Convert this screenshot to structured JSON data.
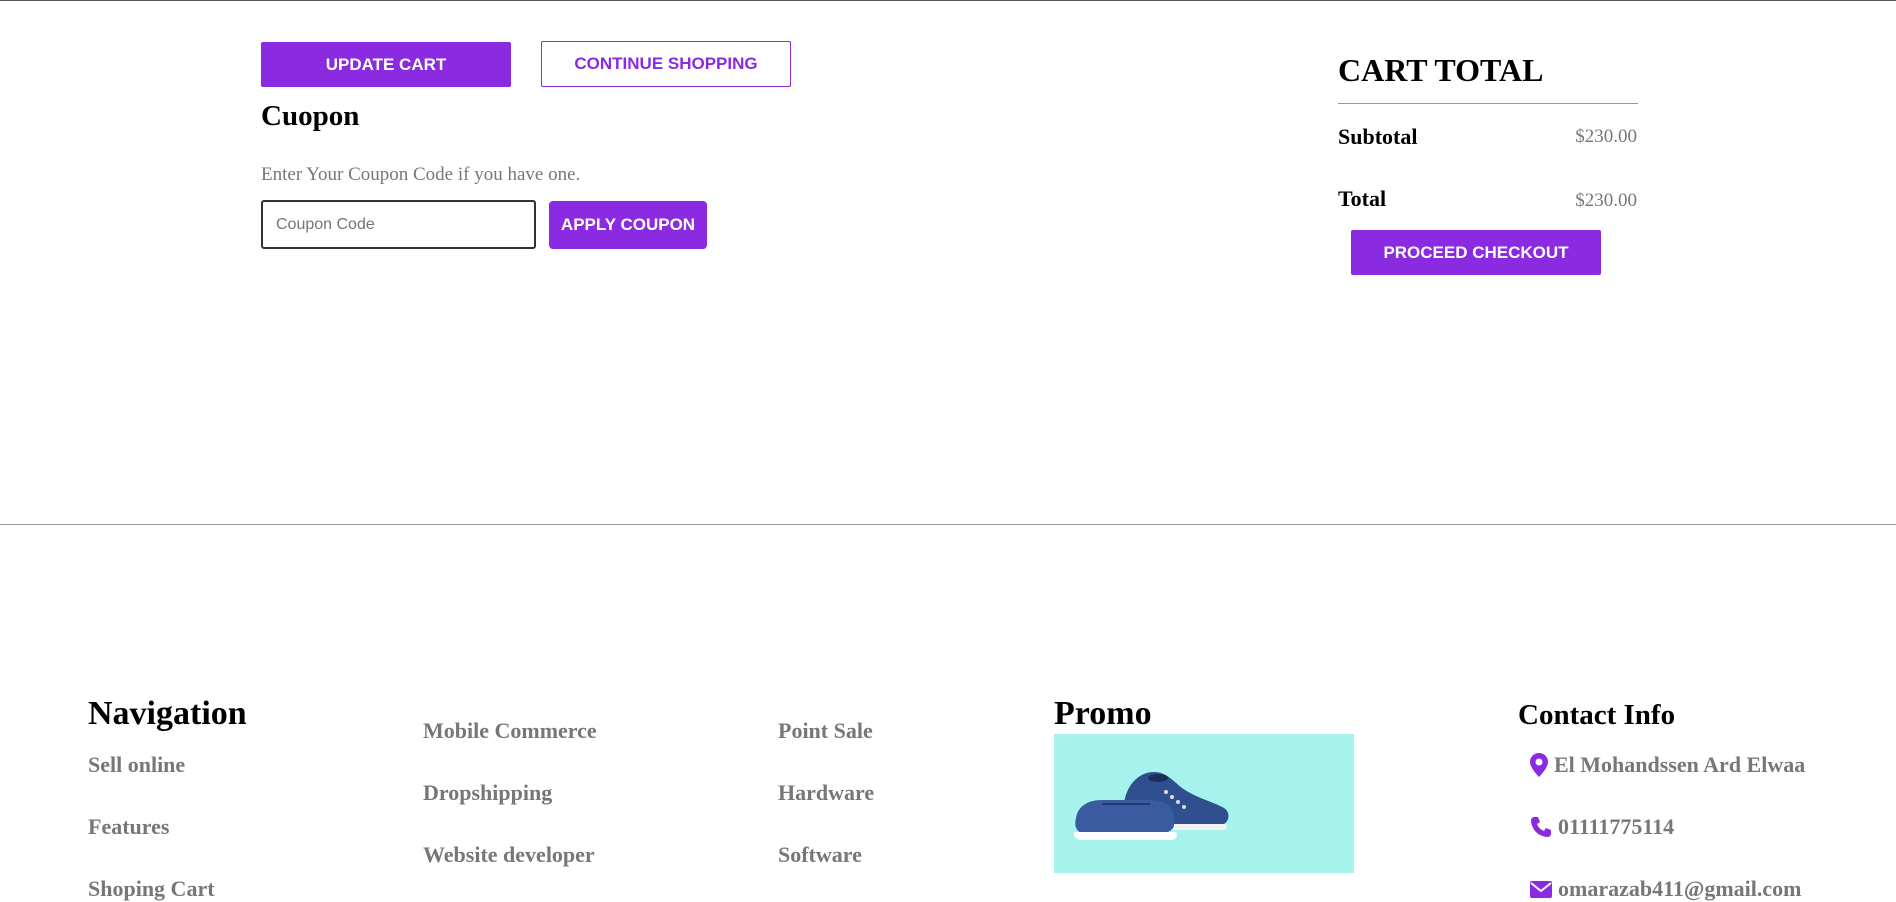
{
  "cart_actions": {
    "update_label": "UPDATE CART",
    "continue_label": "CONTINUE SHOPPING"
  },
  "coupon": {
    "title": "Cuopon",
    "description": "Enter Your Coupon Code if you have one.",
    "placeholder": "Coupon Code",
    "value": "",
    "apply_label": "APPLY COUPON"
  },
  "cart_total": {
    "title": "CART TOTAL",
    "subtotal_label": "Subtotal",
    "subtotal_value": "$230.00",
    "total_label": "Total",
    "total_value": "$230.00",
    "checkout_label": "PROCEED CHECKOUT"
  },
  "footer": {
    "navigation": {
      "heading": "Navigation",
      "col1": [
        "Sell online",
        "Features",
        "Shoping Cart"
      ],
      "col2": [
        "Mobile Commerce",
        "Dropshipping",
        "Website developer"
      ],
      "col3": [
        "Point Sale",
        "Hardware",
        "Software"
      ]
    },
    "promo": {
      "heading": "Promo",
      "image_icon": "sneaker-image"
    },
    "contact": {
      "heading": "Contact Info",
      "address": "El Mohandssen Ard Elwaa",
      "phone": "01111775114",
      "email": "omarazab411@gmail.com"
    }
  },
  "colors": {
    "accent": "#8a2be2",
    "muted_text": "#777777",
    "promo_bg": "#a6f3ee"
  }
}
